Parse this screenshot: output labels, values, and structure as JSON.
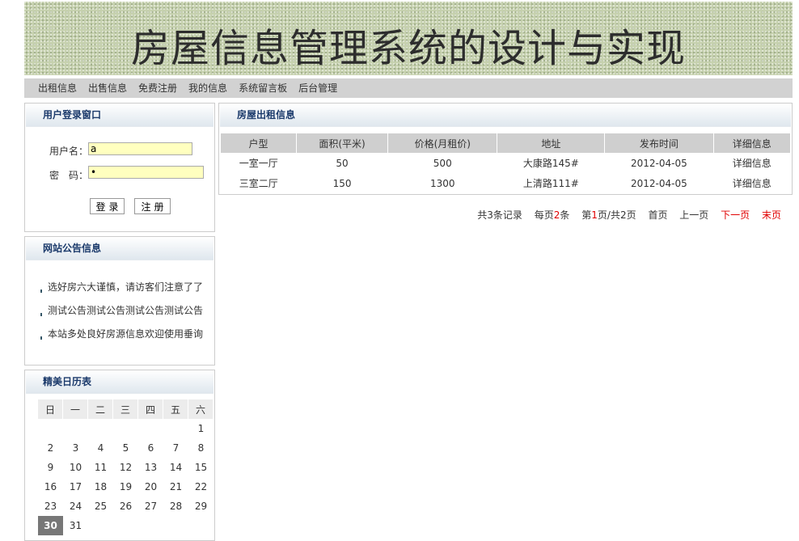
{
  "site": {
    "title": "房屋信息管理系统的设计与实现"
  },
  "nav": [
    {
      "label": "出租信息"
    },
    {
      "label": "出售信息"
    },
    {
      "label": "免费注册"
    },
    {
      "label": "我的信息"
    },
    {
      "label": "系统留言板"
    },
    {
      "label": "后台管理"
    }
  ],
  "login": {
    "title": "用户登录窗口",
    "username_label": "用户名：",
    "username_value": "a",
    "password_label": "密　码：",
    "password_value": "•",
    "login_button": "登录",
    "register_button": "注册"
  },
  "notices": {
    "title": "网站公告信息",
    "items": [
      "选好房六大谨慎，请访客们注意了了",
      "测试公告测试公告测试公告测试公告",
      "本站多处良好房源信息欢迎使用垂询"
    ]
  },
  "calendar": {
    "title": "精美日历表",
    "weekdays": [
      "日",
      "一",
      "二",
      "三",
      "四",
      "五",
      "六"
    ],
    "days": [
      "1",
      "2",
      "3",
      "4",
      "5",
      "6",
      "7",
      "8",
      "9",
      "10",
      "11",
      "12",
      "13",
      "14",
      "15",
      "16",
      "17",
      "18",
      "19",
      "20",
      "21",
      "22",
      "23",
      "24",
      "25",
      "26",
      "27",
      "28",
      "29",
      "30",
      "31"
    ],
    "today": "30"
  },
  "rentals": {
    "title": "房屋出租信息",
    "columns": [
      "户型",
      "面积(平米)",
      "价格(月租价)",
      "地址",
      "发布时间",
      "详细信息"
    ],
    "rows": [
      [
        "一室一厅",
        "50",
        "500",
        "大康路145#",
        "2012-04-05",
        "详细信息"
      ],
      [
        "三室二厅",
        "150",
        "1300",
        "上清路111#",
        "2012-04-05",
        "详细信息"
      ]
    ]
  },
  "pager": {
    "total_prefix": "共",
    "total": "3",
    "total_suffix": "条记录",
    "per_prefix": "每页",
    "per": "2",
    "per_suffix": "条",
    "page_prefix": "第",
    "page": "1",
    "page_mid": "页/共",
    "pages": "2",
    "page_suffix": "页",
    "first": "首页",
    "prev": "上一页",
    "next": "下一页",
    "last": "末页",
    "accent_color": "#e00000"
  }
}
